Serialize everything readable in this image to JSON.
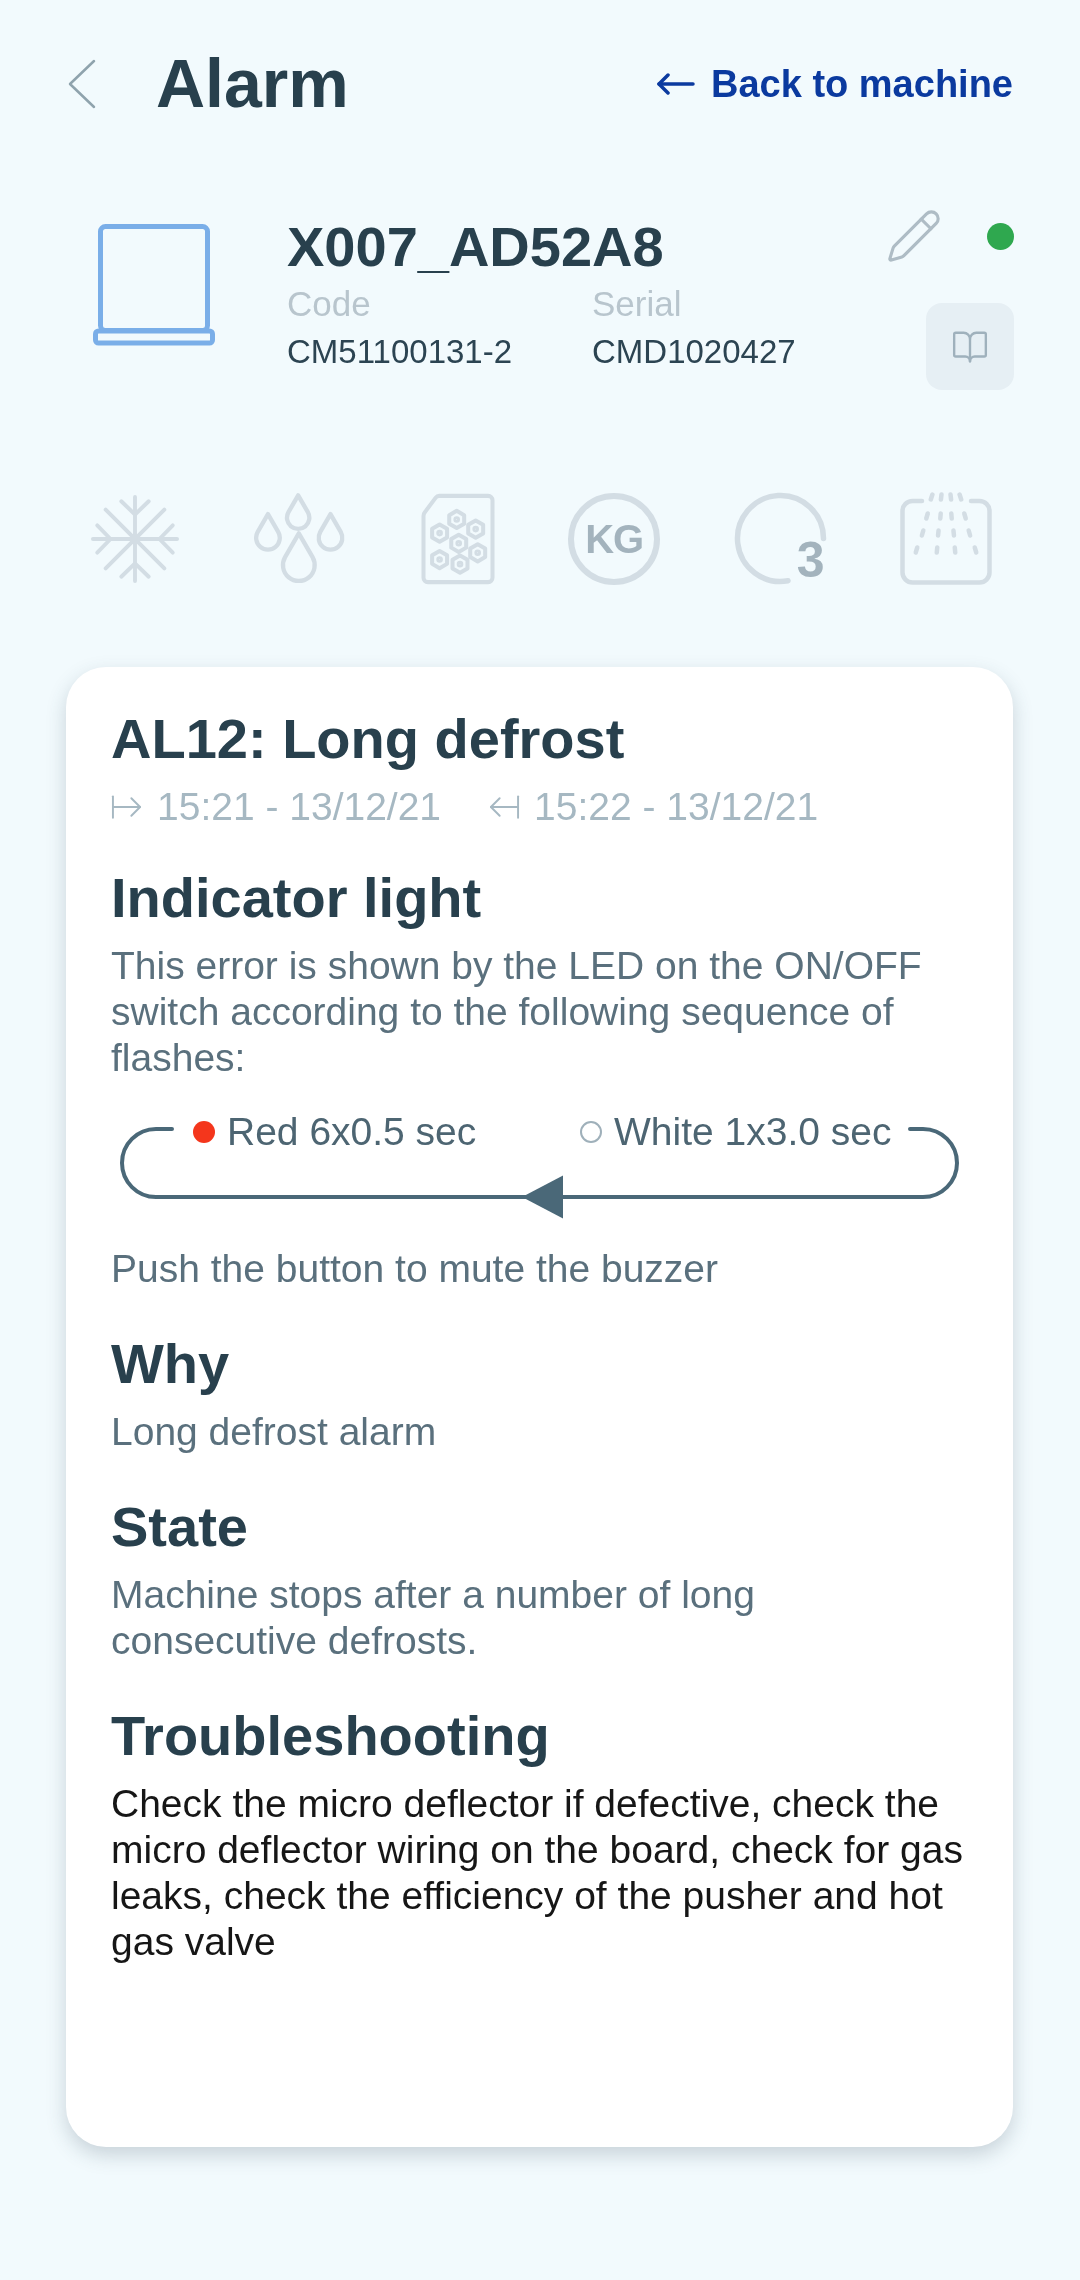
{
  "header": {
    "title": "Alarm",
    "back_link": "Back to machine"
  },
  "machine": {
    "name": "X007_AD52A8",
    "online": true,
    "fields": [
      {
        "label": "Code",
        "value": "CM51100131-2"
      },
      {
        "label": "Serial",
        "value": "CMD1020427"
      }
    ]
  },
  "features": [
    {
      "kind": "snowflake"
    },
    {
      "kind": "drops"
    },
    {
      "kind": "tray"
    },
    {
      "kind": "weight",
      "label": "KG"
    },
    {
      "kind": "ozone",
      "label": "3"
    },
    {
      "kind": "shower"
    }
  ],
  "alarm": {
    "title": "AL12: Long defrost",
    "start_time": "15:21 - 13/12/21",
    "end_time": "15:22 - 13/12/21",
    "sections": [
      {
        "kind": "indicator",
        "heading": "Indicator light",
        "text": "This error is shown by the LED on the ON/OFF switch according to the following sequence of flashes:",
        "sequence": [
          {
            "color": "#f4361c",
            "label": "Red 6x0.5 sec"
          },
          {
            "color": "#ffffff",
            "label": "White 1x3.0 sec"
          }
        ],
        "note": "Push the button to mute the buzzer"
      },
      {
        "kind": "info",
        "heading": "Why",
        "text": "Long defrost alarm"
      },
      {
        "kind": "info",
        "heading": "State",
        "text": "Machine stops after a number of long consecutive defrosts."
      },
      {
        "kind": "action",
        "heading": "Troubleshooting",
        "text": "Check the micro deflector if defective, check the micro deflector wiring on the board, check for gas leaks, check the efficiency of the pusher and hot gas valve"
      }
    ]
  }
}
